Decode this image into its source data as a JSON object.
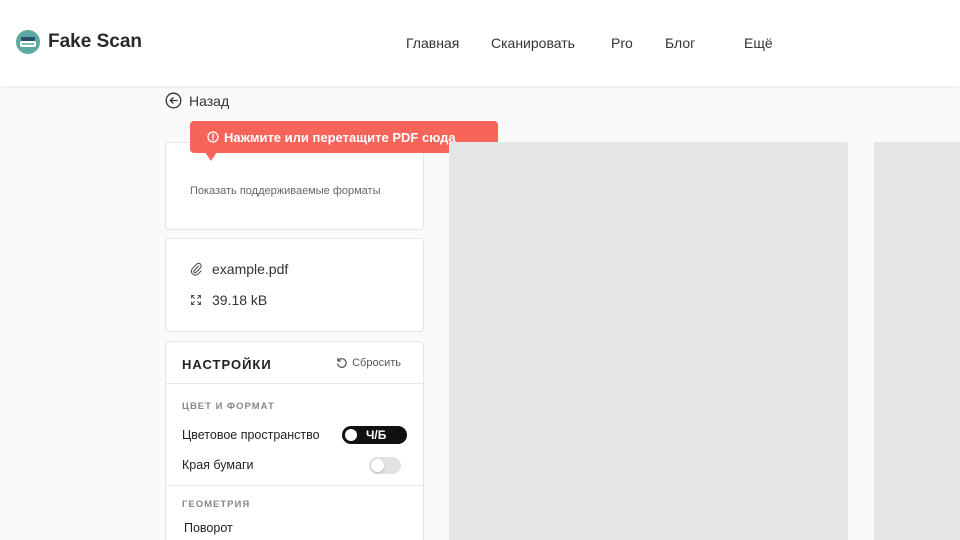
{
  "header": {
    "brand": "Fake Scan",
    "nav": [
      "Главная",
      "Сканировать",
      "Pro",
      "Блог",
      "Ещё"
    ]
  },
  "back": {
    "label": "Назад"
  },
  "upload": {
    "tooltip": "Нажмите или перетащите PDF сюда",
    "formats_link": "Показать поддерживаемые форматы"
  },
  "file": {
    "name": "example.pdf",
    "size": "39.18 kB"
  },
  "settings": {
    "title": "НАСТРОЙКИ",
    "reset": "Сбросить",
    "color_section": "ЦВЕТ И ФОРМАТ",
    "colorspace_label": "Цветовое пространство",
    "colorspace_value": "Ч/Б",
    "edges_label": "Края бумаги",
    "edges_on": false,
    "geometry_section": "ГЕОМЕТРИЯ",
    "rotation_label": "Поворот"
  },
  "icons": {
    "logo": "scanner-logo-icon",
    "back": "arrow-left-circle-icon",
    "tooltip": "info-circle-icon",
    "file": "paperclip-icon",
    "size": "resize-icon",
    "reset": "rotate-ccw-icon"
  },
  "colors": {
    "accent": "#f7645a",
    "toggle_on": "#111111",
    "preview": "#e6e6e6"
  }
}
